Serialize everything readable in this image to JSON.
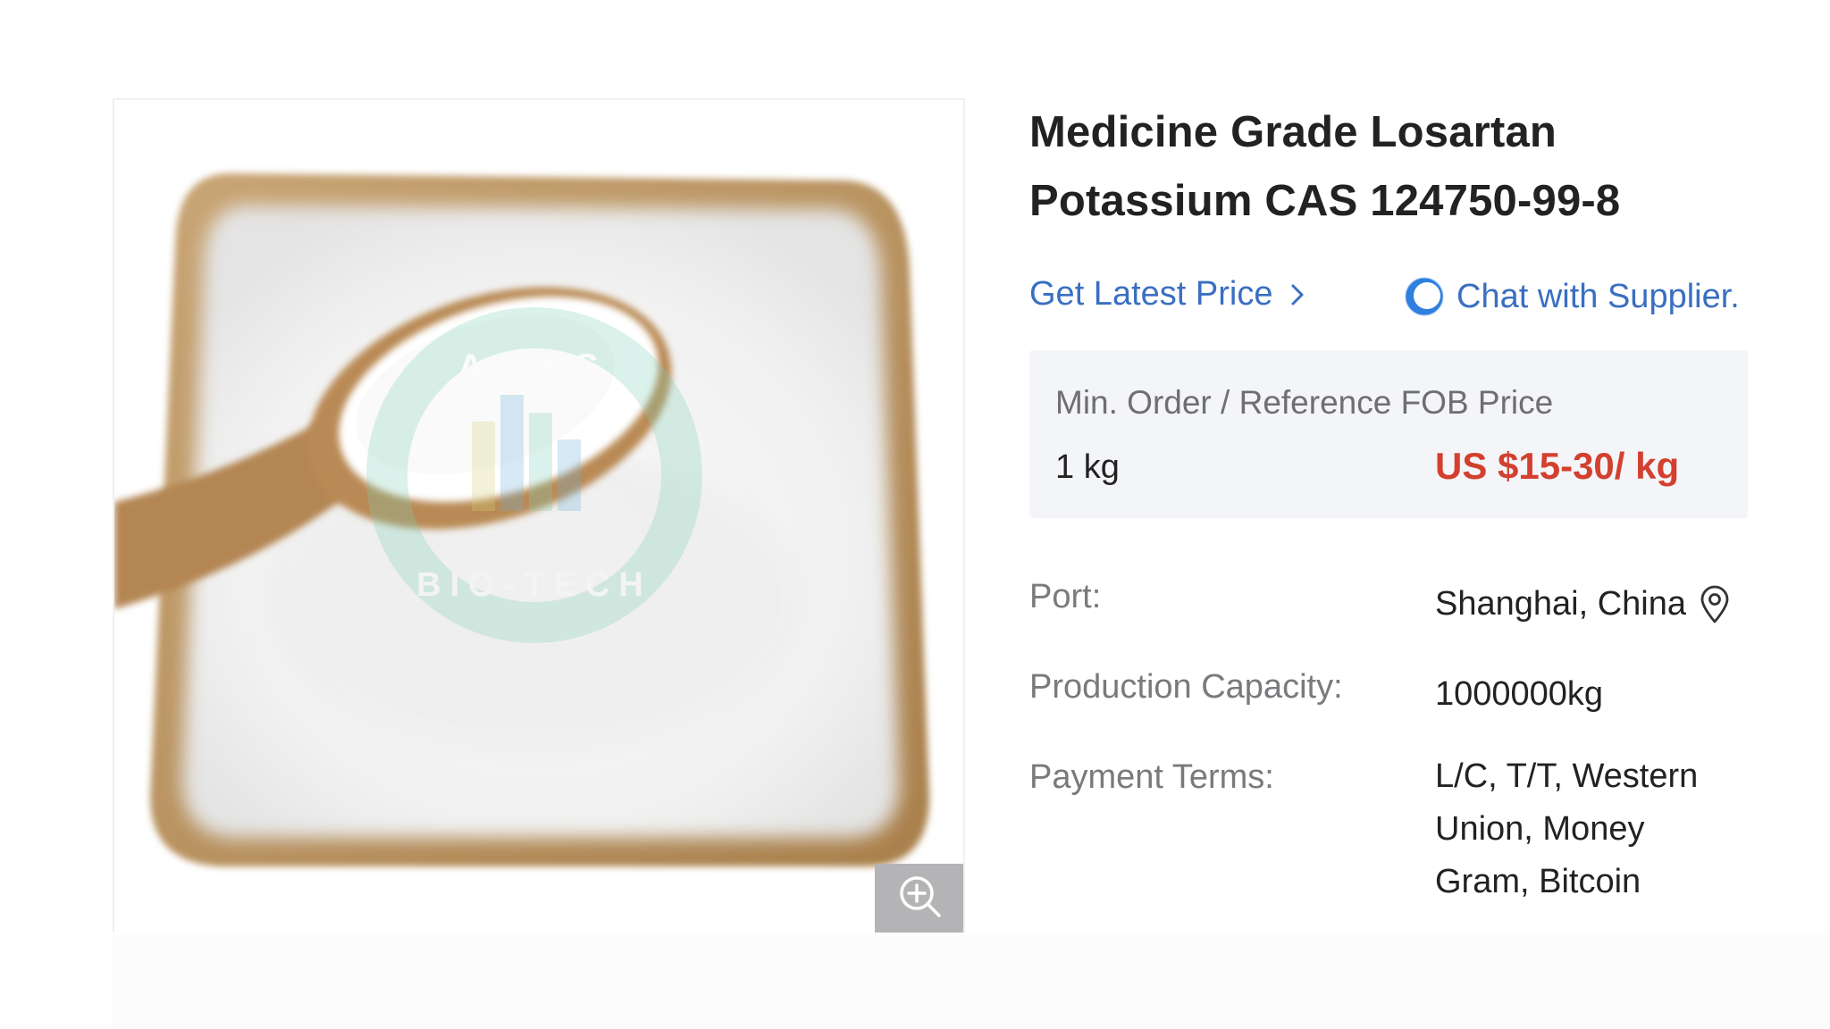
{
  "product": {
    "title": "Medicine Grade Losartan Potassium CAS 124750-99-8",
    "image": {
      "watermark_top": "AOKS",
      "watermark_bottom": "BIO-TECH"
    }
  },
  "actions": {
    "latest_price_label": "Get Latest Price",
    "chat_label": "Chat with Supplier."
  },
  "price_box": {
    "heading": "Min. Order / Reference FOB Price",
    "min_order": "1 kg",
    "price": "US $15-30/ kg"
  },
  "specs": [
    {
      "key": "Port:",
      "value": "Shanghai, China"
    },
    {
      "key": "Production Capacity:",
      "value": "1000000kg"
    },
    {
      "key": "Payment Terms:",
      "value": "L/C, T/T, Western Union, Money Gram, Bitcoin"
    }
  ],
  "icons": {
    "chevron": "chevron-right-icon",
    "chat": "chat-bubble-icon",
    "location": "location-pin-icon",
    "zoom": "zoom-in-icon"
  },
  "colors": {
    "link": "#3a6fc1",
    "price": "#d3402f",
    "price_box_bg": "#f4f5f8",
    "label_gray": "#7a7a7e"
  }
}
